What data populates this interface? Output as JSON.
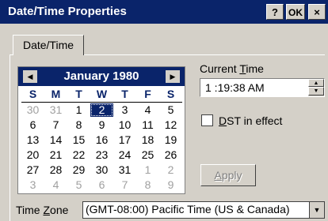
{
  "window": {
    "title": "Date/Time Properties",
    "help": "?",
    "ok": "OK",
    "close": "×"
  },
  "tab": {
    "label": "Date/Time"
  },
  "calendar": {
    "month_label": "January 1980",
    "prev": "◀",
    "next": "▶",
    "dow": [
      "S",
      "M",
      "T",
      "W",
      "T",
      "F",
      "S"
    ],
    "selected_day": "2",
    "weeks": [
      [
        [
          "30",
          1
        ],
        [
          "31",
          1
        ],
        [
          "1",
          0
        ],
        [
          "2",
          0
        ],
        [
          "3",
          0
        ],
        [
          "4",
          0
        ],
        [
          "5",
          0
        ]
      ],
      [
        [
          "6",
          0
        ],
        [
          "7",
          0
        ],
        [
          "8",
          0
        ],
        [
          "9",
          0
        ],
        [
          "10",
          0
        ],
        [
          "11",
          0
        ],
        [
          "12",
          0
        ]
      ],
      [
        [
          "13",
          0
        ],
        [
          "14",
          0
        ],
        [
          "15",
          0
        ],
        [
          "16",
          0
        ],
        [
          "17",
          0
        ],
        [
          "18",
          0
        ],
        [
          "19",
          0
        ]
      ],
      [
        [
          "20",
          0
        ],
        [
          "21",
          0
        ],
        [
          "22",
          0
        ],
        [
          "23",
          0
        ],
        [
          "24",
          0
        ],
        [
          "25",
          0
        ],
        [
          "26",
          0
        ]
      ],
      [
        [
          "27",
          0
        ],
        [
          "28",
          0
        ],
        [
          "29",
          0
        ],
        [
          "30",
          0
        ],
        [
          "31",
          0
        ],
        [
          "1",
          1
        ],
        [
          "2",
          1
        ]
      ],
      [
        [
          "3",
          1
        ],
        [
          "4",
          1
        ],
        [
          "5",
          1
        ],
        [
          "6",
          1
        ],
        [
          "7",
          1
        ],
        [
          "8",
          1
        ],
        [
          "9",
          1
        ]
      ]
    ]
  },
  "current_time": {
    "label_pre": "Current ",
    "label_u": "T",
    "label_post": "ime",
    "value": "1 :19:38 AM",
    "up": "▲",
    "down": "▼"
  },
  "dst": {
    "label_u": "D",
    "label_rest": "ST in effect",
    "checked": false
  },
  "apply": {
    "label_u": "A",
    "label_rest": "pply"
  },
  "time_zone": {
    "label_pre": "Time ",
    "label_u": "Z",
    "label_post": "one",
    "value": "(GMT-08:00) Pacific Time (US & Canada)",
    "arrow": "▼"
  }
}
